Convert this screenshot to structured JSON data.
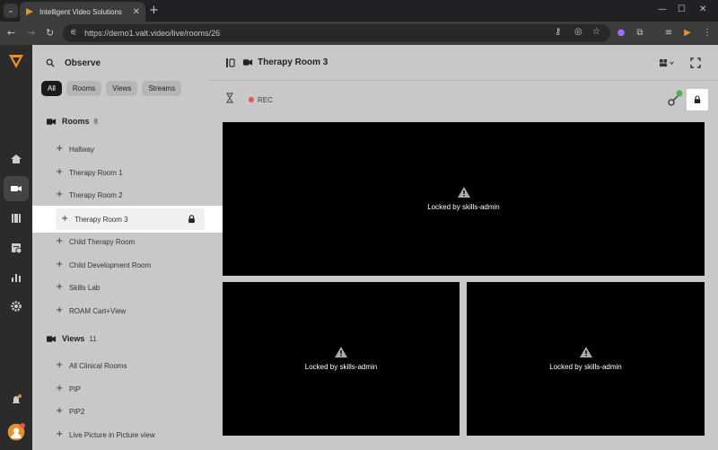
{
  "browser": {
    "tab_title": "Intelligent Video Solutions",
    "url": "https://demo1.valt.video/live/rooms/26"
  },
  "sidebar": {
    "title": "Observe",
    "filters": [
      {
        "label": "All",
        "active": true
      },
      {
        "label": "Rooms",
        "active": false
      },
      {
        "label": "Views",
        "active": false
      },
      {
        "label": "Streams",
        "active": false
      }
    ],
    "rooms": {
      "title": "Rooms",
      "count": "8",
      "items": [
        "Hallway",
        "Therapy Room 1",
        "Therapy Room 2",
        "Therapy Room 3",
        "Child Therapy Room",
        "Child Development Room",
        "Skills Lab",
        "ROAM Cart+View"
      ]
    },
    "views": {
      "title": "Views",
      "count": "11",
      "items": [
        "All Clinical Rooms",
        "PIP",
        "PIP2",
        "Live Picture in Picture view"
      ]
    }
  },
  "main": {
    "room_title": "Therapy Room 3",
    "rec_label": "REC",
    "videos": [
      {
        "locked_text": "Locked by skills-admin"
      },
      {
        "locked_text": "Locked by skills-admin"
      },
      {
        "locked_text": "Locked by skills-admin"
      }
    ]
  },
  "colors": {
    "rec": "#e05a47",
    "badge_green": "#4caf50",
    "brand_orange": "#e8902a"
  }
}
